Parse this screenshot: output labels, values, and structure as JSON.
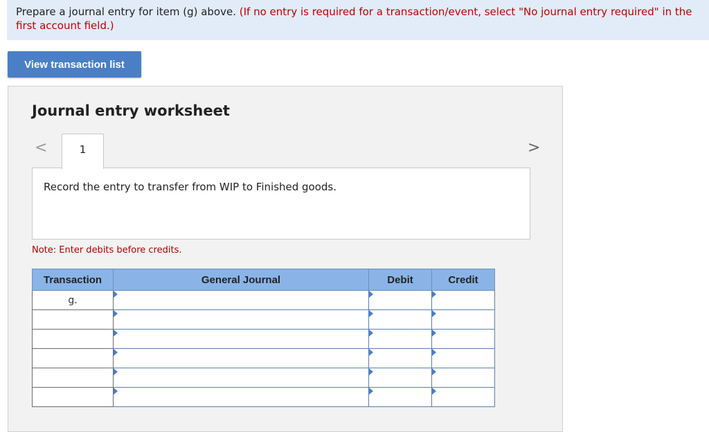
{
  "instructions": {
    "main": "Prepare a journal entry for item (g) above.",
    "hint": "(If no entry is required for a transaction/event, select \"No journal entry required\" in the first account field.)"
  },
  "view_button": "View transaction list",
  "worksheet": {
    "title": "Journal entry worksheet",
    "prev_icon": "<",
    "next_icon": ">",
    "tab_label": "1",
    "description": "Record the entry to transfer from WIP to Finished goods.",
    "note": "Note: Enter debits before credits."
  },
  "table": {
    "headers": [
      "Transaction",
      "General Journal",
      "Debit",
      "Credit"
    ],
    "rows": [
      {
        "transaction": "g."
      },
      {
        "transaction": ""
      },
      {
        "transaction": ""
      },
      {
        "transaction": ""
      },
      {
        "transaction": ""
      },
      {
        "transaction": ""
      }
    ]
  },
  "colors": {
    "header_bg": "#8ab4e8",
    "button_bg": "#4a7fc6",
    "banner_bg": "#e1ecf8",
    "note_red": "#c00000"
  }
}
